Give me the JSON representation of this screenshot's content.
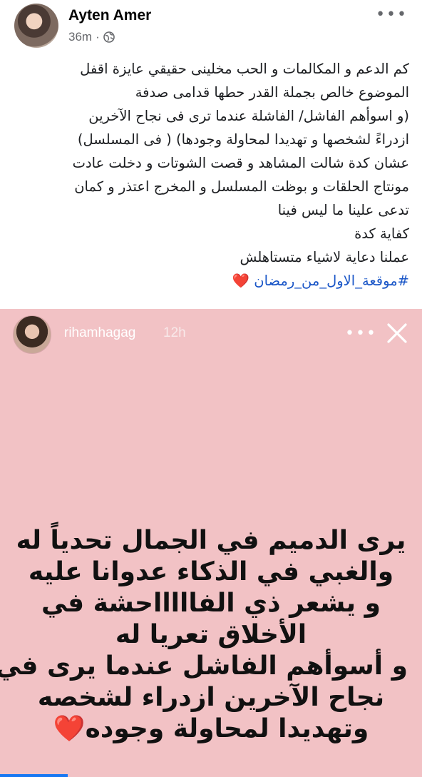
{
  "post": {
    "author": "Ayten Amer",
    "time": "36m",
    "separator": "·",
    "more_icon": "more-horizontal-icon",
    "privacy_icon": "globe-icon",
    "text_lines": [
      "كم الدعم و المكالمات و الحب مخلينى حقيقي عايزة اقفل",
      "الموضوع خالص بجملة القدر حطها قدامى صدفة",
      "(و اسوأهم الفاشل/ الفاشلة عندما ترى فى نجاح الآخرين",
      "ازدراءً لشخصها و تهديدا لمحاولة وجودها) ( فى المسلسل)",
      "عشان كدة شالت المشاهد و قصت الشوتات و دخلت عادت",
      "مونتاج الحلقات و بوظت المسلسل و المخرج اعتذر و كمان",
      "تدعى علينا ما ليس فينا",
      "كفاية كدة",
      "عملنا دعاية لاشياء متستاهلش"
    ],
    "hashtag": "#موقعة_الاول_من_رمضان",
    "hashtag_emoji": "❤️"
  },
  "story": {
    "username": "rihamhagag",
    "time": "12h",
    "background_color": "#f2c2c5",
    "text_lines": [
      "يرى الدميم في الجمال تحدياً له",
      "والغبي في الذكاء عدوانا عليه",
      "و  يشعر ذي الفاااااحشة في",
      "الأخلاق تعريا له",
      "و أسوأهم الفاشل عندما يرى في",
      "نجاح الآخرين ازدراء لشخصه",
      "وتهديدا لمحاولة وجوده"
    ],
    "end_emoji": "❤️"
  }
}
